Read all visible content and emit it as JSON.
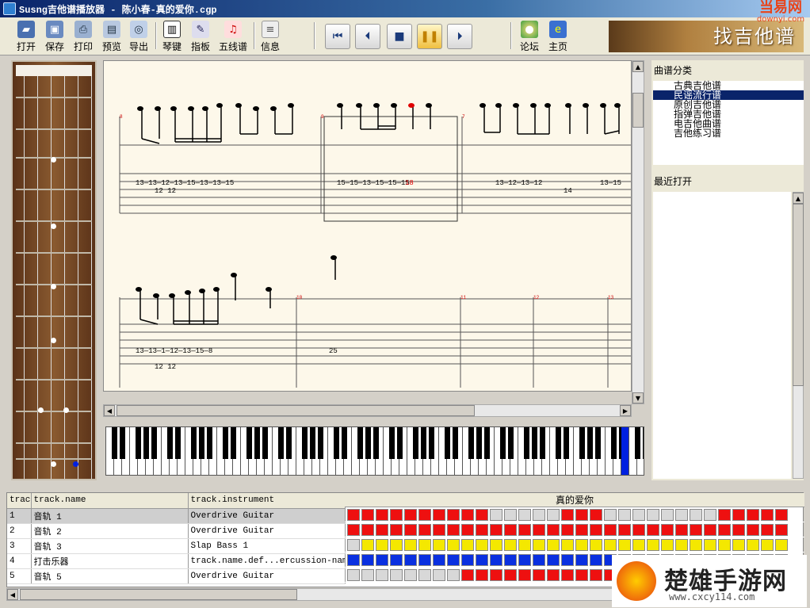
{
  "window": {
    "title": "Susng吉他谱播放器 - 陈小春-真的爱你.cgp"
  },
  "watermark_top": {
    "text": "当易网",
    "url": "downyi.com"
  },
  "toolbar": {
    "file_buttons": [
      "打开",
      "保存",
      "打印",
      "预览",
      "导出"
    ],
    "view_buttons": [
      "琴键",
      "指板",
      "五线谱"
    ],
    "info_button": "信息",
    "playback": [
      "skip-start",
      "previous",
      "stop",
      "pause",
      "next"
    ],
    "link_buttons": [
      "论坛",
      "主页"
    ]
  },
  "banner": {
    "text": "找吉他谱"
  },
  "score": {
    "measure_numbers": [
      "8",
      "9",
      "7",
      "10",
      "11",
      "12",
      "13"
    ],
    "row1_tab": {
      "m1": "13—13—12—13—15—13—13—15",
      "m1_low": "12  12",
      "m2": "15—15—13—15—15—15",
      "m2_red": "18",
      "m3": "13—12—13—12",
      "m3_low": "14",
      "m3_end": "13—15"
    },
    "row2_tab": {
      "m1": "13—13—1—12—13—15—8",
      "m1_low": "12  12",
      "m2": "25"
    }
  },
  "sidebar": {
    "category_header": "曲谱分类",
    "categories": [
      "古典吉他谱",
      "民谣流行谱",
      "原创吉他谱",
      "指弹吉他谱",
      "电吉他曲谱",
      "吉他练习谱"
    ],
    "selected_category": "民谣流行谱",
    "recent_header": "最近打开"
  },
  "tracks": {
    "headers": {
      "num": "trac",
      "name": "track.name",
      "instrument": "track.instrument",
      "song": "真的爱你"
    },
    "rows": [
      {
        "num": "1",
        "name": "音轨 1",
        "instrument": "Overdrive Guitar",
        "color": "#ee1010"
      },
      {
        "num": "2",
        "name": "音轨 2",
        "instrument": "Overdrive Guitar",
        "color": "#ee1010"
      },
      {
        "num": "3",
        "name": "音轨 3",
        "instrument": "Slap Bass 1",
        "color": "#f4e800"
      },
      {
        "num": "4",
        "name": "打击乐器",
        "instrument": "track.name.def...ercussion-name",
        "color": "#0a30e0"
      },
      {
        "num": "5",
        "name": "音轨 5",
        "instrument": "Overdrive Guitar",
        "color": "#ee1010"
      }
    ]
  },
  "watermark_bottom": {
    "text": "楚雄手游网",
    "url": "www.cxcy114.com"
  }
}
